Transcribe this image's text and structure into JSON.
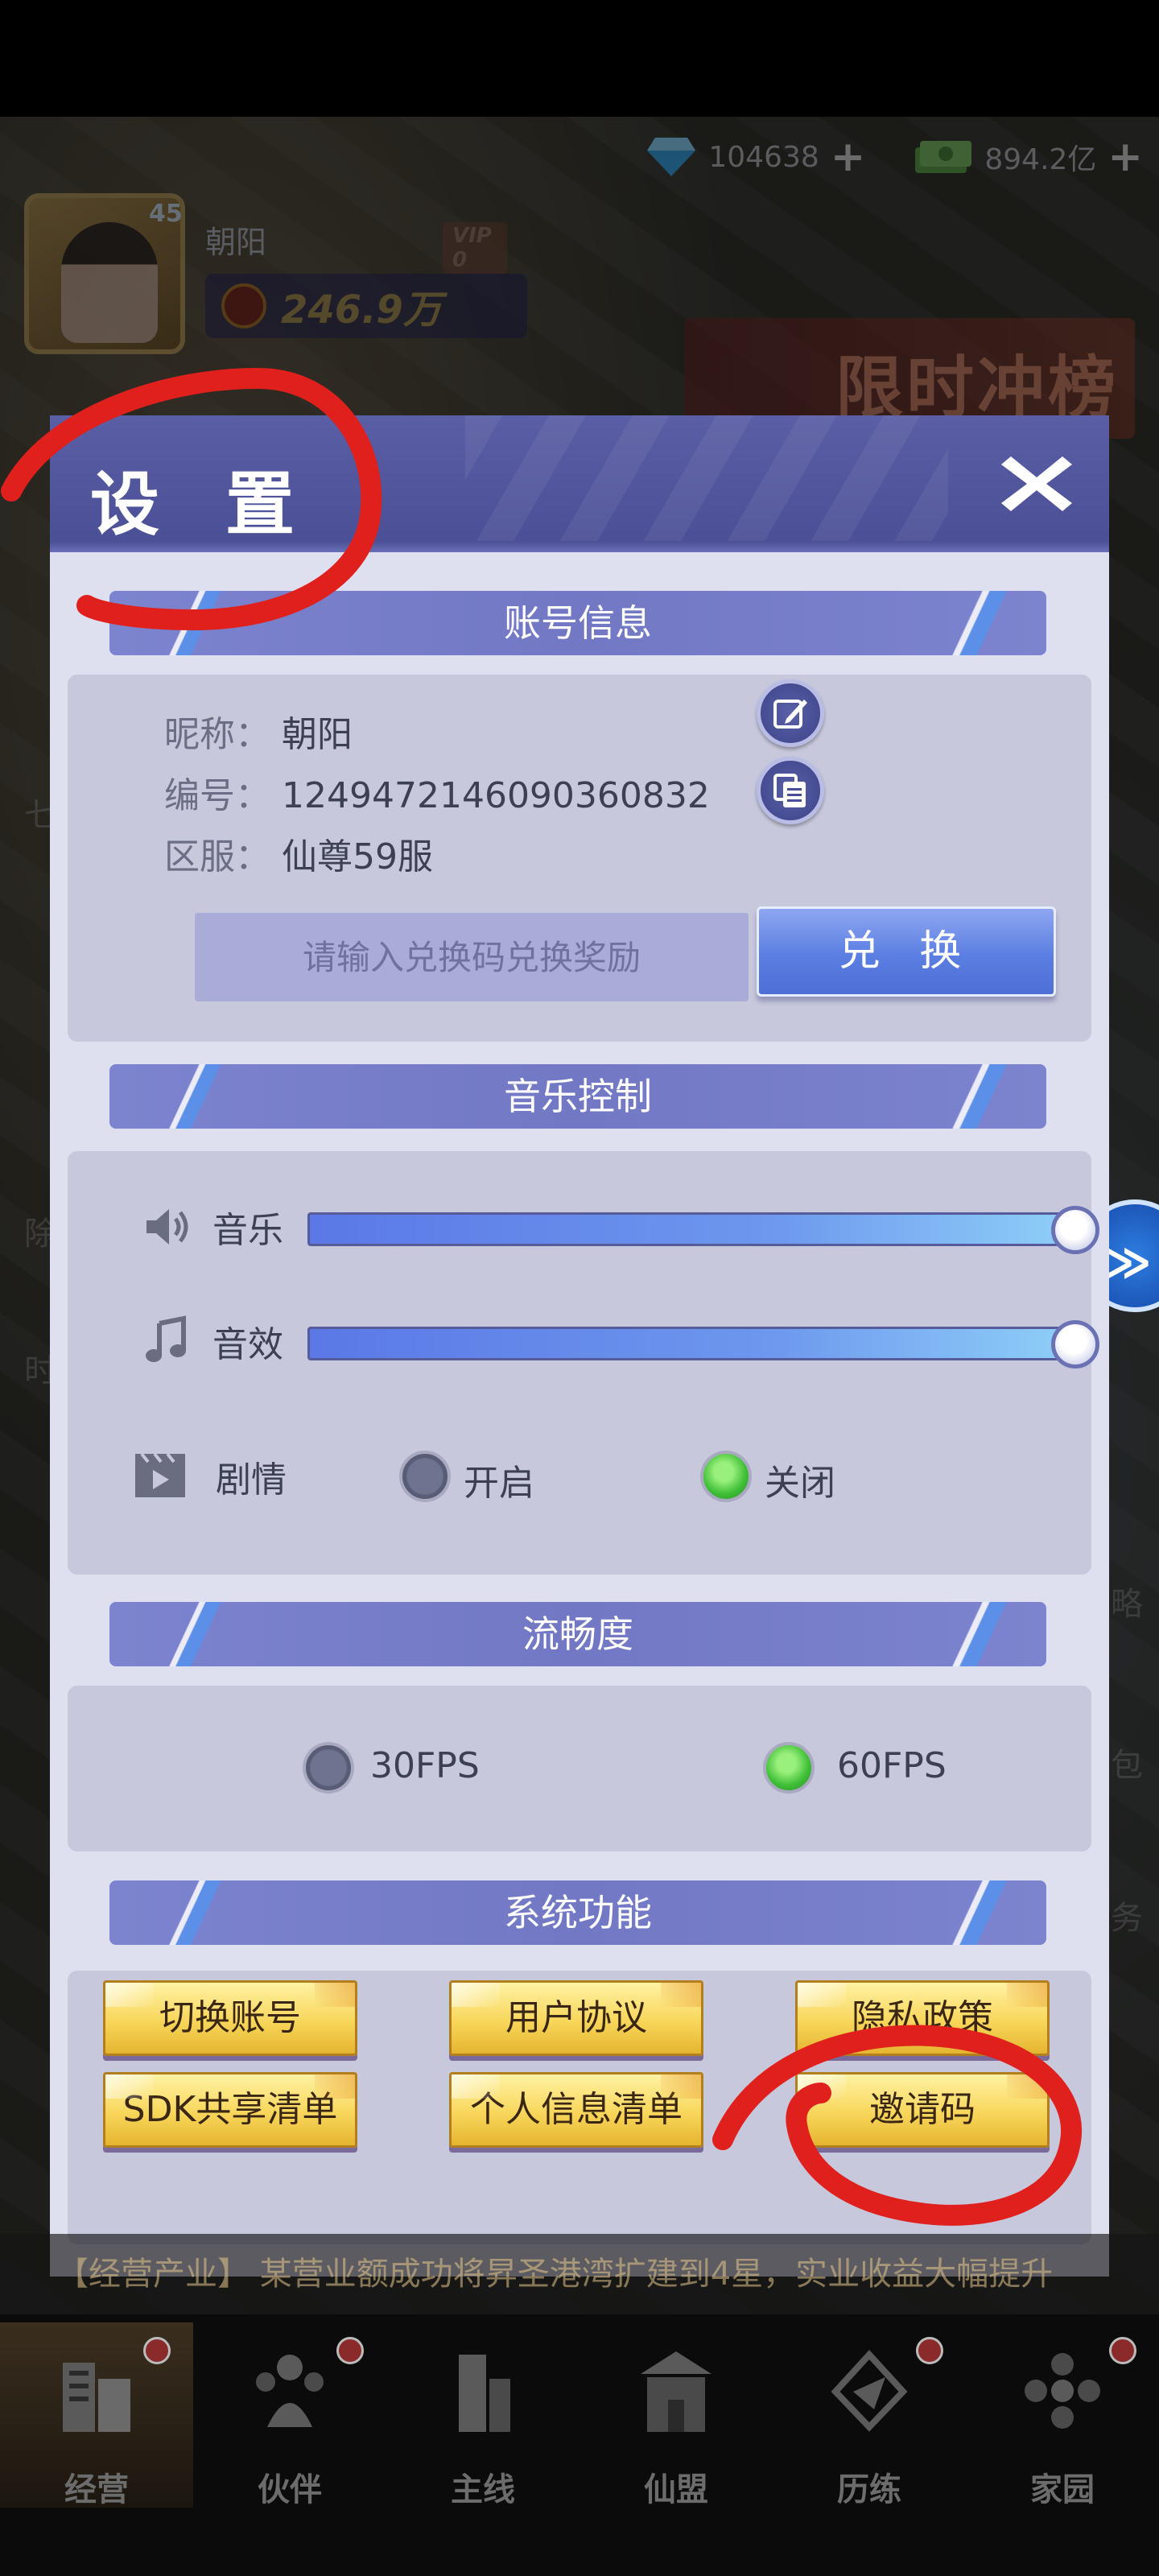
{
  "topbar": {
    "diamonds": "104638",
    "money": "894.2亿"
  },
  "player": {
    "level": "45",
    "name": "朝阳",
    "vip": "VIP 0",
    "power": "246.9万"
  },
  "event_banner": "限时冲榜",
  "dialog": {
    "title": "设 置",
    "account": {
      "section_title": "账号信息",
      "nickname_label": "昵称：",
      "nickname": "朝阳",
      "id_label": "编号：",
      "id": "1249472146090360832",
      "server_label": "区服：",
      "server": "仙尊59服",
      "redeem_placeholder": "请输入兑换码兑换奖励",
      "redeem_button": "兑 换"
    },
    "music": {
      "section_title": "音乐控制",
      "music_label": "音乐",
      "music_level": 1.0,
      "sfx_label": "音效",
      "sfx_level": 1.0,
      "story_label": "剧情",
      "story_on_label": "开启",
      "story_off_label": "关闭",
      "story_selected": "关闭"
    },
    "fps": {
      "section_title": "流畅度",
      "option_30": "30FPS",
      "option_60": "60FPS",
      "selected": "60FPS"
    },
    "system": {
      "section_title": "系统功能",
      "buttons": [
        "切换账号",
        "用户协议",
        "隐私政策",
        "SDK共享清单",
        "个人信息清单",
        "邀请码"
      ]
    }
  },
  "ticker": "【经营产业】 某营业额成功将昇圣港湾扩建到4星，实业收益大幅提升",
  "bottom_nav": [
    {
      "label": "经营",
      "icon": "building-icon"
    },
    {
      "label": "伙伴",
      "icon": "partners-icon"
    },
    {
      "label": "主线",
      "icon": "tower-icon"
    },
    {
      "label": "仙盟",
      "icon": "palace-icon"
    },
    {
      "label": "历练",
      "icon": "plane-icon"
    },
    {
      "label": "家园",
      "icon": "flower-icon"
    }
  ],
  "colors": {
    "header": "#4a4f95",
    "section_bar": "#7278c4",
    "panel": "#c7c8dc",
    "gold_button": "#f8d65a",
    "annotation": "#e0201c"
  }
}
